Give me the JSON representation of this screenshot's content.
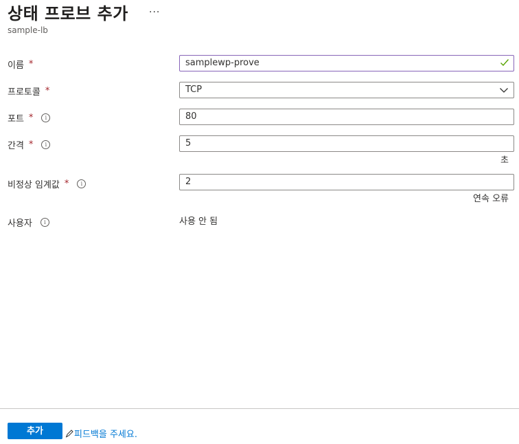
{
  "header": {
    "title": "상태 프로브 추가",
    "more_label": "···",
    "subtitle": "sample-lb"
  },
  "form": {
    "name": {
      "label": "이름",
      "required_mark": "*",
      "value": "samplewp-prove"
    },
    "protocol": {
      "label": "프로토콜",
      "required_mark": "*",
      "value": "TCP"
    },
    "port": {
      "label": "포트",
      "required_mark": "*",
      "value": "80"
    },
    "interval": {
      "label": "간격",
      "required_mark": "*",
      "value": "5",
      "unit": "초"
    },
    "threshold": {
      "label": "비정상 임계값",
      "required_mark": "*",
      "value": "2",
      "unit": "연속 오류"
    },
    "used_by": {
      "label": "사용자",
      "value": "사용 안 됨"
    }
  },
  "footer": {
    "add_label": "추가",
    "feedback_label": "피드백을 주세요."
  },
  "colors": {
    "primary": "#0078d4",
    "required": "#a4262c",
    "focus_border": "#8764b8",
    "valid_check": "#57a300"
  }
}
